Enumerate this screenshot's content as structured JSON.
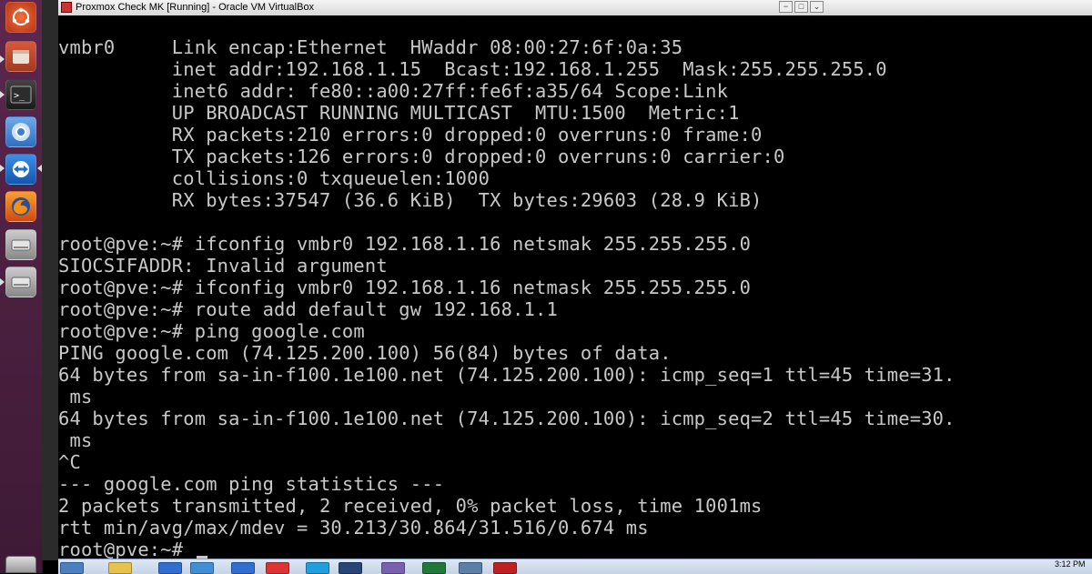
{
  "window": {
    "title": "Proxmox Check MK [Running] - Oracle VM VirtualBox"
  },
  "launcher": {
    "items": [
      {
        "name": "ubuntu-dash-icon",
        "color": "#e95420"
      },
      {
        "name": "files-icon",
        "color": "#b94a2c"
      },
      {
        "name": "terminal-icon",
        "color": "#2c2c2c"
      },
      {
        "name": "chromium-icon",
        "color": "#3b7fd4"
      },
      {
        "name": "teamviewer-icon",
        "color": "#1b6fcf"
      },
      {
        "name": "firefox-icon",
        "color": "#e66000"
      },
      {
        "name": "drive-icon",
        "color": "#9a9a9a"
      },
      {
        "name": "drive-icon-2",
        "color": "#9a9a9a"
      }
    ]
  },
  "terminal": {
    "prompt": "root@pve:~# ",
    "lines": [
      "vmbr0     Link encap:Ethernet  HWaddr 08:00:27:6f:0a:35",
      "          inet addr:192.168.1.15  Bcast:192.168.1.255  Mask:255.255.255.0",
      "          inet6 addr: fe80::a00:27ff:fe6f:a35/64 Scope:Link",
      "          UP BROADCAST RUNNING MULTICAST  MTU:1500  Metric:1",
      "          RX packets:210 errors:0 dropped:0 overruns:0 frame:0",
      "          TX packets:126 errors:0 dropped:0 overruns:0 carrier:0",
      "          collisions:0 txqueuelen:1000",
      "          RX bytes:37547 (36.6 KiB)  TX bytes:29603 (28.9 KiB)",
      "",
      "root@pve:~# ifconfig vmbr0 192.168.1.16 netsmak 255.255.255.0",
      "SIOCSIFADDR: Invalid argument",
      "root@pve:~# ifconfig vmbr0 192.168.1.16 netmask 255.255.255.0",
      "root@pve:~# route add default gw 192.168.1.1",
      "root@pve:~# ping google.com",
      "PING google.com (74.125.200.100) 56(84) bytes of data.",
      "64 bytes from sa-in-f100.1e100.net (74.125.200.100): icmp_seq=1 ttl=45 time=31.",
      " ms",
      "64 bytes from sa-in-f100.1e100.net (74.125.200.100): icmp_seq=2 ttl=45 time=30.",
      " ms",
      "^C",
      "--- google.com ping statistics ---",
      "2 packets transmitted, 2 received, 0% packet loss, time 1001ms",
      "rtt min/avg/max/mdev = 30.213/30.864/31.516/0.674 ms"
    ],
    "current_prompt": "root@pve:~# "
  },
  "taskbar": {
    "clock": "3:12 PM",
    "items": [
      {
        "name": "start-icon",
        "color": "#4a7fc1"
      },
      {
        "name": "explorer-icon",
        "color": "#e8c24a"
      },
      {
        "name": "ie-icon",
        "color": "#2f6fd1"
      },
      {
        "name": "media-icon",
        "color": "#3f8fd6"
      },
      {
        "name": "outlook-icon",
        "color": "#2f6fd1"
      },
      {
        "name": "chrome-icon",
        "color": "#d33"
      },
      {
        "name": "skype-icon",
        "color": "#1ea0e0"
      },
      {
        "name": "virtualbox-icon",
        "color": "#28457a"
      },
      {
        "name": "app-icon",
        "color": "#7a5fb0"
      },
      {
        "name": "excel-icon",
        "color": "#1f7a3a"
      },
      {
        "name": "network-icon",
        "color": "#5a7fa8"
      },
      {
        "name": "filezilla-icon",
        "color": "#c0201f"
      }
    ]
  }
}
